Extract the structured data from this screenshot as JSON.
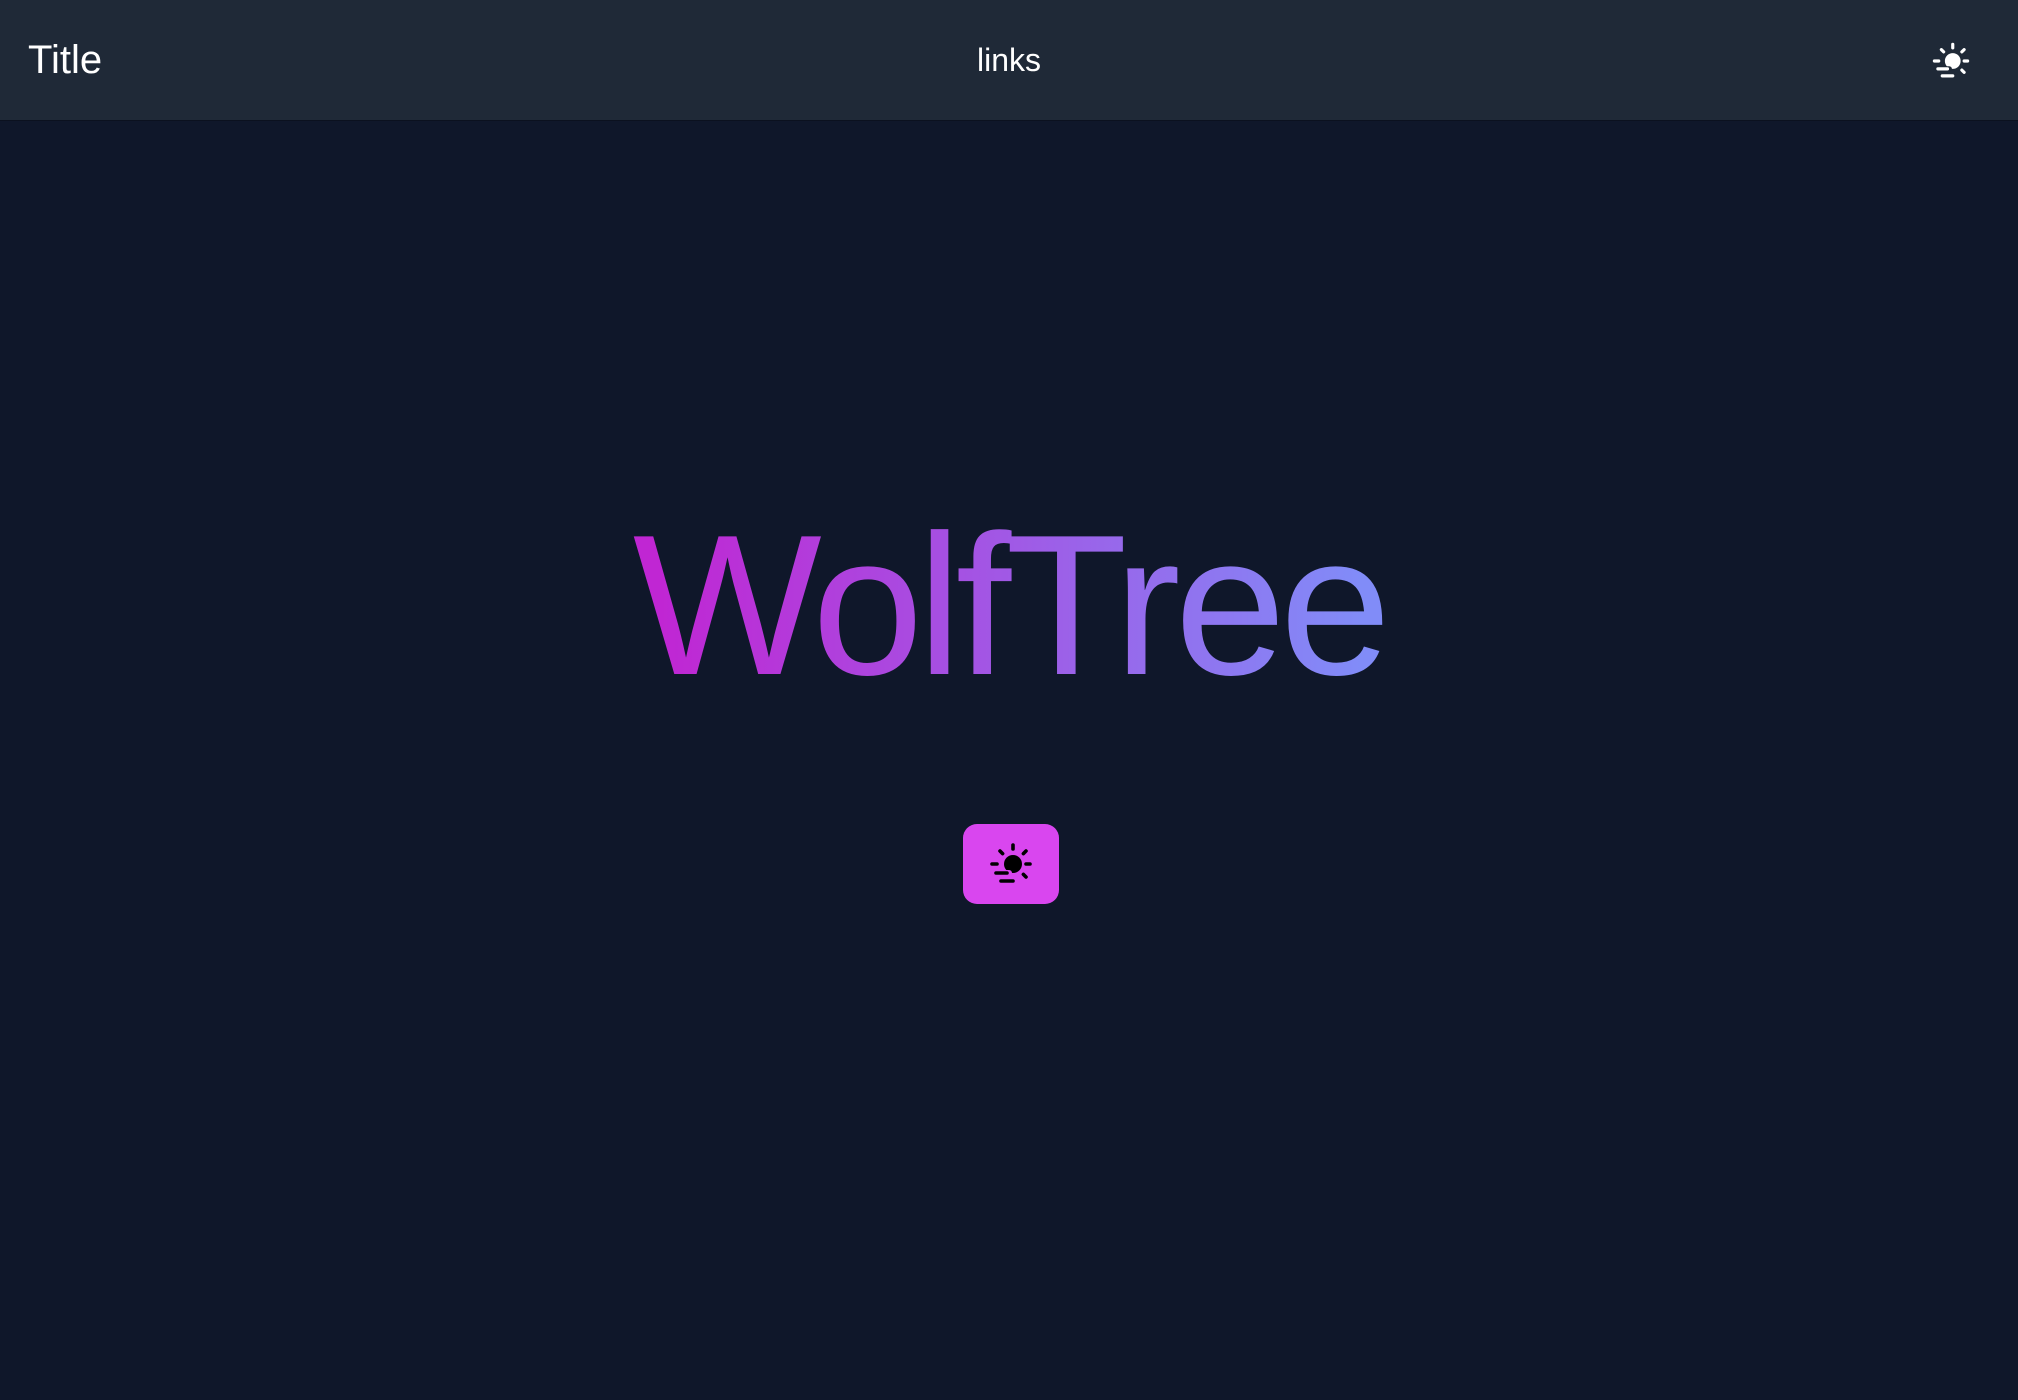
{
  "navbar": {
    "title": "Title",
    "links_label": "links",
    "theme_toggle_icon": "sun-horizon-icon"
  },
  "hero": {
    "brand_text": "WolfTree",
    "gradient_colors": [
      "#c026d3",
      "#818cf8"
    ],
    "button_icon": "sun-horizon-icon",
    "button_color": "#d946ef"
  },
  "colors": {
    "background": "#0f172a",
    "navbar": "#1f2937",
    "nav_text": "#ffffff"
  }
}
